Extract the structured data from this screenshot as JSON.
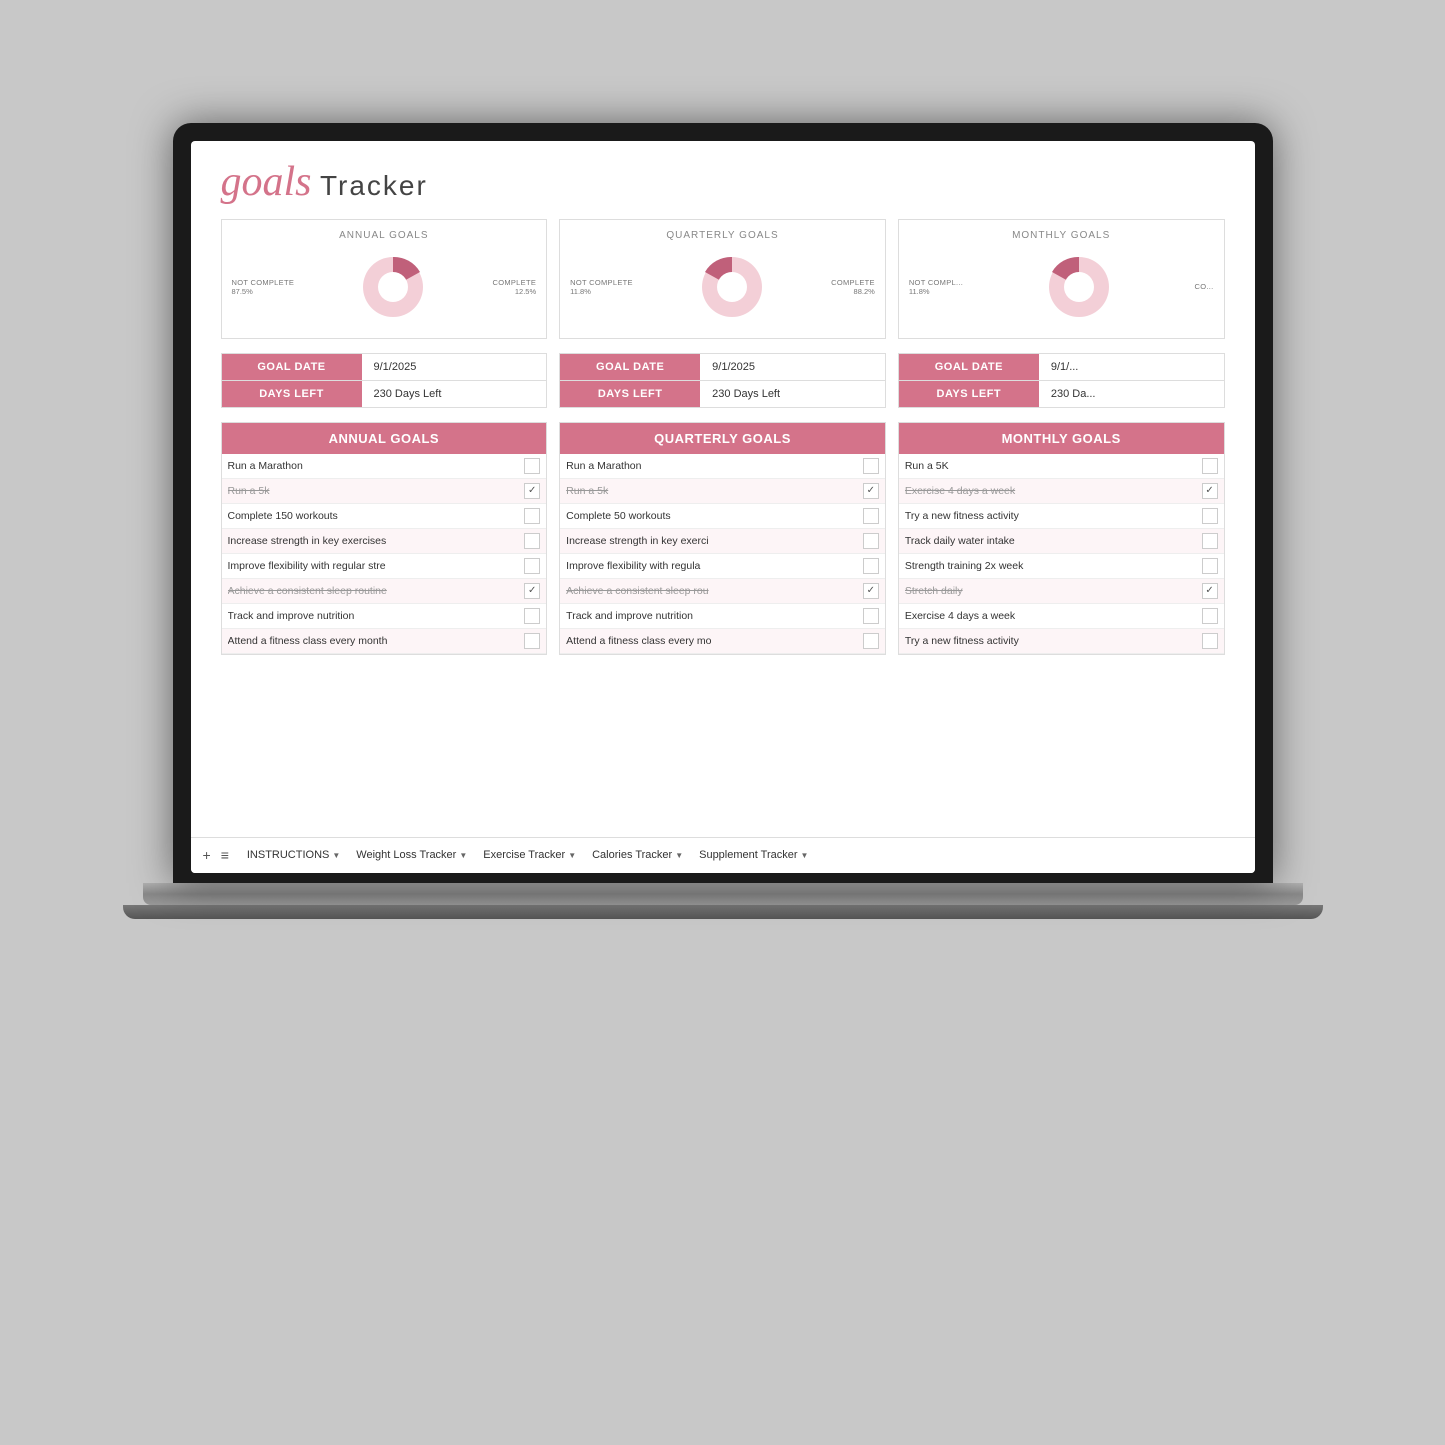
{
  "app": {
    "title": "goals Tracker"
  },
  "header": {
    "title_script": "goals",
    "title_main": "Tracker"
  },
  "charts": [
    {
      "id": "annual",
      "title": "ANNUAL GOALS",
      "complete_label": "COMPLETE",
      "complete_pct": "12.5%",
      "not_complete_label": "NOT COMPLETE",
      "not_complete_pct": "87.5%",
      "complete_deg": 45,
      "not_complete_deg": 315
    },
    {
      "id": "quarterly",
      "title": "QUARTERLY GOALS",
      "complete_label": "COMPLETE",
      "complete_pct": "88.2%",
      "not_complete_label": "NOT COMPLETE",
      "not_complete_pct": "11.8%",
      "complete_deg": 317,
      "not_complete_deg": 43
    },
    {
      "id": "monthly",
      "title": "MONTHLY GOALS",
      "complete_label": "CO...",
      "complete_pct": "",
      "not_complete_label": "NOT COMPL...",
      "not_complete_pct": "11.8%",
      "complete_deg": 317,
      "not_complete_deg": 43
    }
  ],
  "goal_dates": [
    {
      "date_label": "GOAL DATE",
      "date_value": "9/1/2025",
      "days_label": "DAYS LEFT",
      "days_value": "230 Days Left"
    },
    {
      "date_label": "GOAL DATE",
      "date_value": "9/1/2025",
      "days_label": "DAYS LEFT",
      "days_value": "230 Days Left"
    },
    {
      "date_label": "GOAL DATE",
      "date_value": "9/1/...",
      "days_label": "DAYS LEFT",
      "days_value": "230 Da..."
    }
  ],
  "annual_goals": {
    "header": "ANNUAL GOALS",
    "items": [
      {
        "text": "Run a Marathon",
        "strikethrough": false,
        "checked": false
      },
      {
        "text": "Run a 5k",
        "strikethrough": true,
        "checked": true
      },
      {
        "text": "Complete 150 workouts",
        "strikethrough": false,
        "checked": false
      },
      {
        "text": "Increase strength in key exercises",
        "strikethrough": false,
        "checked": false
      },
      {
        "text": "Improve flexibility with regular stre",
        "strikethrough": false,
        "checked": false
      },
      {
        "text": "Achieve a consistent sleep routine",
        "strikethrough": true,
        "checked": true
      },
      {
        "text": "Track and improve nutrition",
        "strikethrough": false,
        "checked": false
      },
      {
        "text": "Attend a fitness class every month",
        "strikethrough": false,
        "checked": false
      }
    ]
  },
  "quarterly_goals": {
    "header": "QUARTERLY GOALS",
    "items": [
      {
        "text": "Run a Marathon",
        "strikethrough": false,
        "checked": false
      },
      {
        "text": "Run a 5k",
        "strikethrough": true,
        "checked": true
      },
      {
        "text": "Complete 50 workouts",
        "strikethrough": false,
        "checked": false
      },
      {
        "text": "Increase strength in key exerci",
        "strikethrough": false,
        "checked": false
      },
      {
        "text": "Improve flexibility with regula",
        "strikethrough": false,
        "checked": false
      },
      {
        "text": "Achieve a consistent sleep rou",
        "strikethrough": true,
        "checked": true
      },
      {
        "text": "Track and improve nutrition",
        "strikethrough": false,
        "checked": false
      },
      {
        "text": "Attend a fitness class every mo",
        "strikethrough": false,
        "checked": false
      }
    ]
  },
  "monthly_goals": {
    "header": "MONTHLY GOALS",
    "items": [
      {
        "text": "Run a 5K",
        "strikethrough": false,
        "checked": false
      },
      {
        "text": "Exercise 4 days a week",
        "strikethrough": true,
        "checked": true
      },
      {
        "text": "Try a new fitness activity",
        "strikethrough": false,
        "checked": false
      },
      {
        "text": "Track daily water intake",
        "strikethrough": false,
        "checked": false
      },
      {
        "text": "Strength training 2x week",
        "strikethrough": false,
        "checked": false
      },
      {
        "text": "Stretch daily",
        "strikethrough": true,
        "checked": true
      },
      {
        "text": "Exercise 4 days a week",
        "strikethrough": false,
        "checked": false
      },
      {
        "text": "Try a new fitness activity",
        "strikethrough": false,
        "checked": false
      }
    ]
  },
  "bottom_nav": {
    "plus": "+",
    "menu": "≡",
    "items": [
      {
        "label": "INSTRUCTIONS",
        "has_arrow": true
      },
      {
        "label": "Weight Loss Tracker",
        "has_arrow": true
      },
      {
        "label": "Exercise Tracker",
        "has_arrow": true
      },
      {
        "label": "Calories Tracker",
        "has_arrow": true
      },
      {
        "label": "Supplement Tracker",
        "has_arrow": true
      }
    ]
  }
}
